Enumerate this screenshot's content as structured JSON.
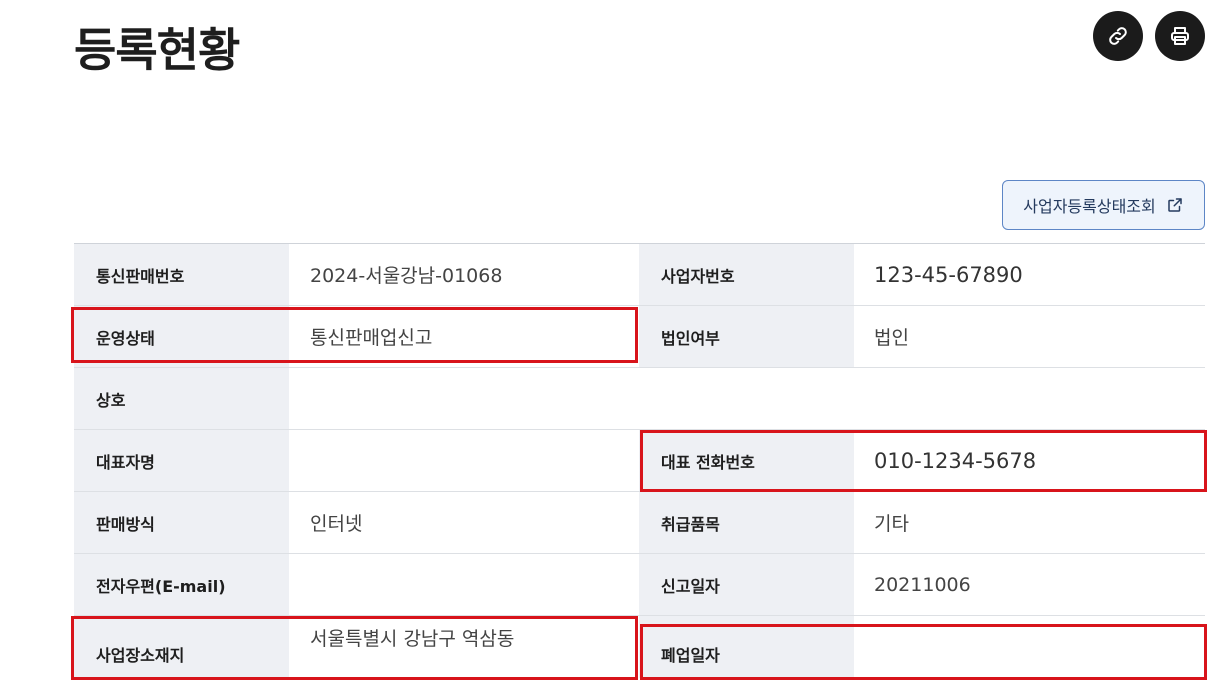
{
  "header": {
    "title": "등록현황"
  },
  "toolbar": {
    "link_icon": "link-icon",
    "print_icon": "print-icon"
  },
  "status_button": {
    "label": "사업자등록상태조회",
    "icon": "external-link-icon"
  },
  "table": {
    "rows": [
      {
        "left_label": "통신판매번호",
        "left_value": "2024-서울강남-01068",
        "right_label": "사업자번호",
        "right_value": "123-45-67890"
      },
      {
        "left_label": "운영상태",
        "left_value": "통신판매업신고",
        "right_label": "법인여부",
        "right_value": "법인"
      },
      {
        "left_label": "상호",
        "left_value": ""
      },
      {
        "left_label": "대표자명",
        "left_value": "",
        "right_label": "대표 전화번호",
        "right_value": "010-1234-5678"
      },
      {
        "left_label": "판매방식",
        "left_value": "인터넷",
        "right_label": "취급품목",
        "right_value": "기타"
      },
      {
        "left_label": "전자우편(E-mail)",
        "left_value": "",
        "right_label": "신고일자",
        "right_value": "20211006"
      },
      {
        "left_label": "사업장소재지",
        "left_value": "서울특별시 강남구 역삼동",
        "right_label": "폐업일자",
        "right_value": ""
      }
    ]
  },
  "colors": {
    "highlight": "#d8141b",
    "label_bg": "#eef0f4",
    "button_border": "#5d86c6"
  }
}
